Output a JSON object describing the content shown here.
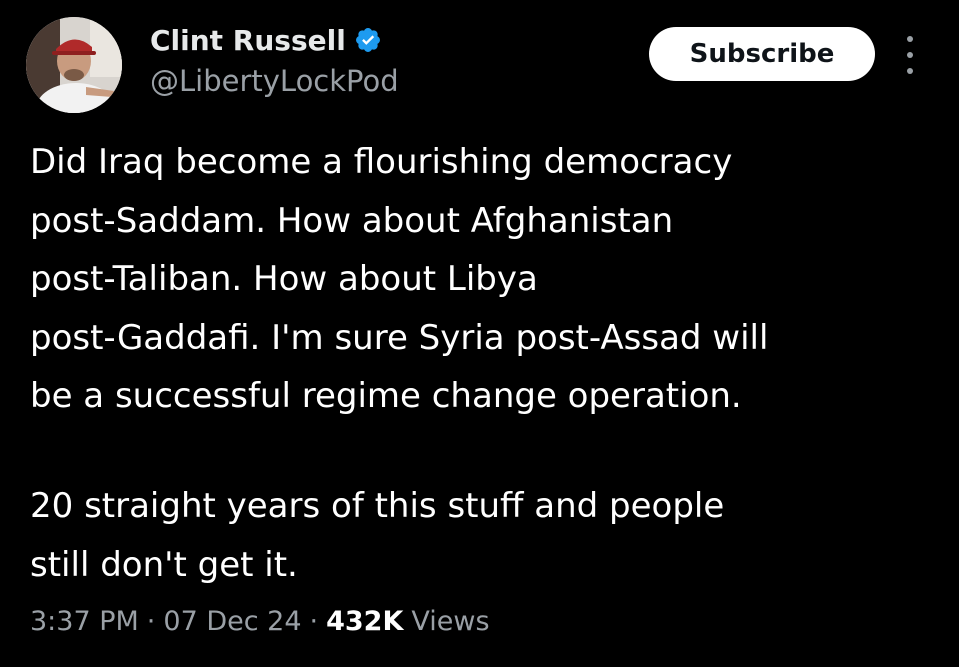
{
  "author": {
    "display_name": "Clint Russell",
    "handle": "@LibertyLockPod",
    "verified": true
  },
  "actions": {
    "subscribe_label": "Subscribe",
    "more_icon": "more-vertical-icon"
  },
  "post": {
    "paragraph_1": "Did Iraq become a flourishing democracy\npost-Saddam. How about Afghanistan\npost-Taliban. How about Libya\npost-Gaddafi. I'm sure Syria post-Assad will\nbe a successful regime change operation.",
    "paragraph_2": "20 straight years of this stuff and people\nstill don't get it."
  },
  "meta": {
    "time": "3:37 PM",
    "date": "07 Dec 24",
    "separator": "·",
    "views_count": "432K",
    "views_label": "Views"
  },
  "colors": {
    "background": "#000000",
    "text_primary": "#ffffff",
    "text_secondary": "#9aa0a6",
    "verified_badge": "#1d9bf0",
    "subscribe_bg": "#ffffff",
    "subscribe_text": "#0f1419"
  }
}
